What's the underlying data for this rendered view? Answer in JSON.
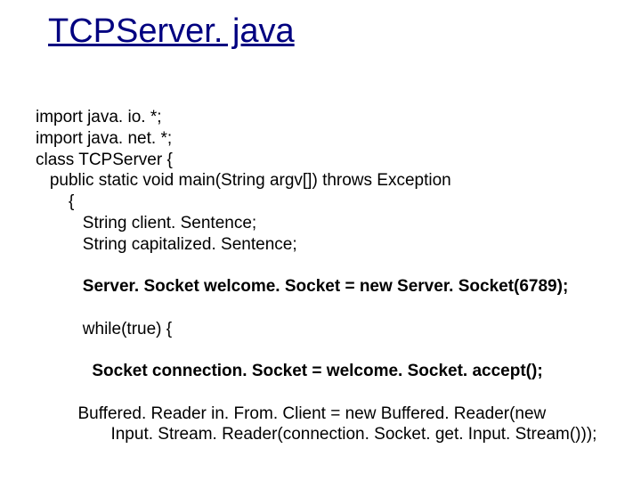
{
  "title": "TCPServer. java",
  "code": {
    "l1": "import java. io. *;",
    "l2": "import java. net. *;",
    "l3": "class TCPServer {",
    "l4": "   public static void main(String argv[]) throws Exception",
    "l5": "       {",
    "l6": "          String client. Sentence;",
    "l7": "          String capitalized. Sentence;",
    "l8": "",
    "l9": "          Server. Socket welcome. Socket = new Server. Socket(6789);",
    "l10": "",
    "l11": "          while(true) {",
    "l12": "",
    "l13": "            Socket connection. Socket = welcome. Socket. accept();",
    "l14": "",
    "l15": "         Buffered. Reader in. From. Client = new Buffered. Reader(new",
    "l16": "                Input. Stream. Reader(connection. Socket. get. Input. Stream()));"
  }
}
